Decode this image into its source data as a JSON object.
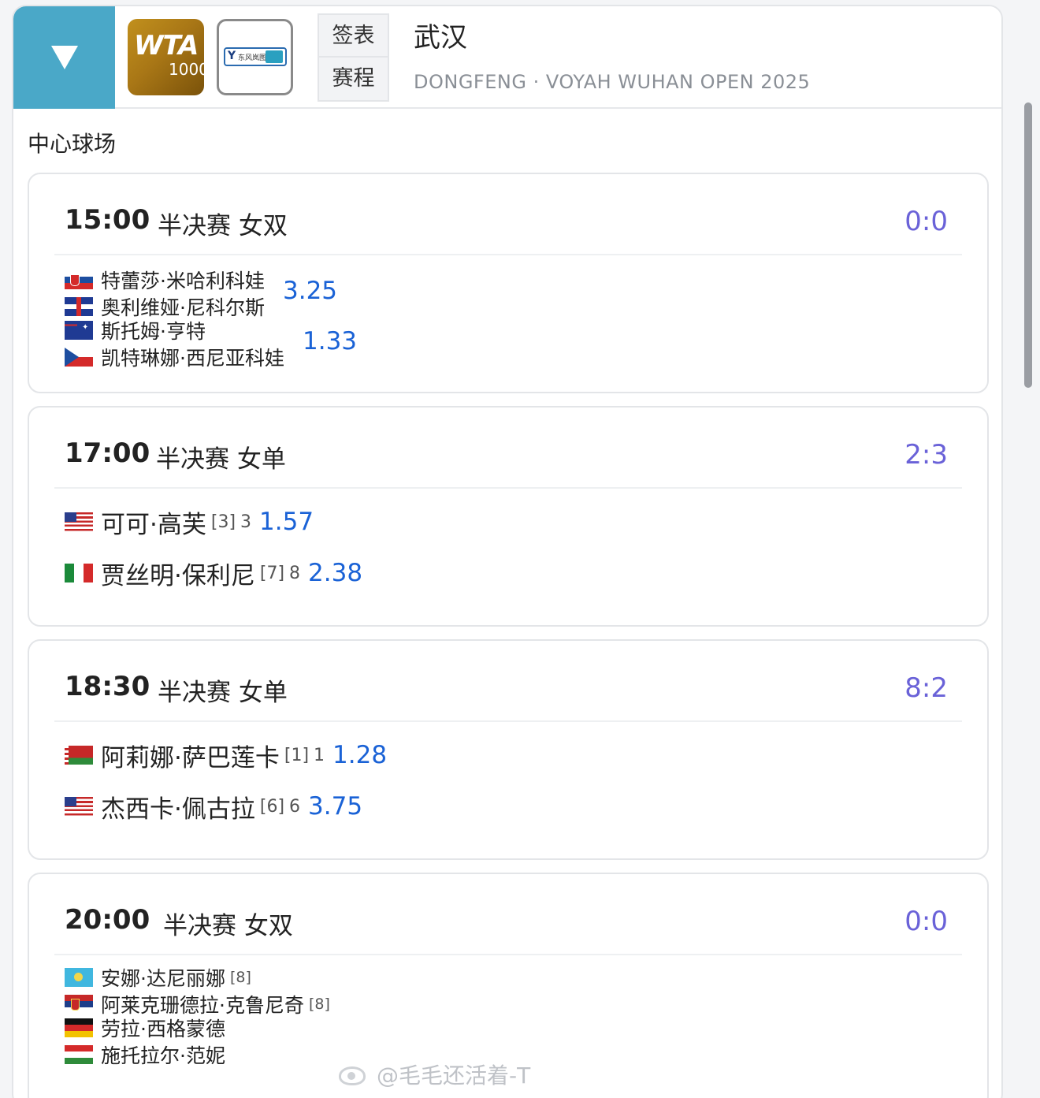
{
  "header": {
    "wta_logo": {
      "text": "WTA",
      "tier": "1000"
    },
    "sponsor_logo": {
      "text": "东风岚图"
    },
    "nav": {
      "draw": "签表",
      "schedule": "赛程"
    },
    "city": "武汉",
    "event_name": "DONGFENG · VOYAH WUHAN OPEN 2025"
  },
  "court": "中心球场",
  "matches": [
    {
      "time": "15:00",
      "stage": "半决赛 女双",
      "score": "0:0",
      "team1": {
        "players": [
          {
            "name": "特蕾莎·米哈利科娃",
            "flag": "SVK"
          },
          {
            "name": "奥利维娅·尼科尔斯",
            "flag": "GBR"
          }
        ],
        "odds": "3.25"
      },
      "team2": {
        "players": [
          {
            "name": "斯托姆·亨特",
            "flag": "AUS"
          },
          {
            "name": "凯特琳娜·西尼亚科娃",
            "flag": "CZE"
          }
        ],
        "odds": "1.33"
      }
    },
    {
      "time": "17:00",
      "stage": "半决赛 女单",
      "score": "2:3",
      "player1": {
        "name": "可可·高芙",
        "flag": "USA",
        "seed": "[3]",
        "rank": "3",
        "odds": "1.57"
      },
      "player2": {
        "name": "贾丝明·保利尼",
        "flag": "ITA",
        "seed": "[7]",
        "rank": "8",
        "odds": "2.38"
      }
    },
    {
      "time": "18:30",
      "stage": "半决赛 女单",
      "score": "8:2",
      "player1": {
        "name": "阿莉娜·萨巴莲卡",
        "flag": "BLR",
        "seed": "[1]",
        "rank": "1",
        "odds": "1.28"
      },
      "player2": {
        "name": "杰西卡·佩古拉",
        "flag": "USA",
        "seed": "[6]",
        "rank": "6",
        "odds": "3.75"
      }
    },
    {
      "time": "20:00",
      "stage": "半决赛 女双",
      "score": "0:0",
      "team1": {
        "players": [
          {
            "name": "安娜·达尼丽娜",
            "flag": "KAZ",
            "seed": "[8]"
          },
          {
            "name": "阿莱克珊德拉·克鲁尼奇",
            "flag": "SRB",
            "seed": "[8]"
          }
        ]
      },
      "team2": {
        "players": [
          {
            "name": "劳拉·西格蒙德",
            "flag": "GER"
          },
          {
            "name": "施托拉尔·范妮",
            "flag": "HUN"
          }
        ]
      }
    }
  ],
  "watermark": "@毛毛还活着-T"
}
